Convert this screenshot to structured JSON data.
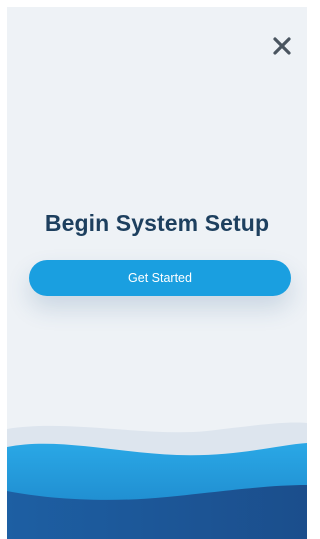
{
  "setup": {
    "title": "Begin System Setup",
    "cta_label": "Get Started"
  },
  "icons": {
    "close": "close-icon"
  },
  "colors": {
    "background": "#eef2f6",
    "title": "#1d3f5e",
    "accent": "#1a9fe0",
    "close_icon": "#4a5560",
    "wave_dark": "#1f5a9a",
    "wave_mid": "#1d8fd0"
  }
}
